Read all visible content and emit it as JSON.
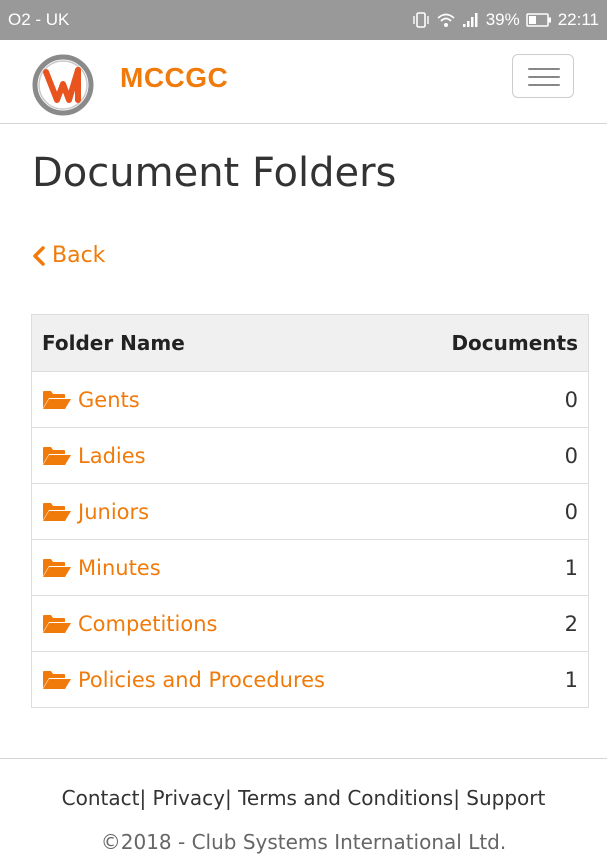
{
  "status_bar": {
    "carrier": "O2 - UK",
    "battery": "39%",
    "time": "22:11"
  },
  "navbar": {
    "brand": "MCCGC",
    "logo_icon": "club-logo-icon",
    "menu_icon": "hamburger-menu-icon"
  },
  "page": {
    "title": "Document Folders",
    "back_label": "Back"
  },
  "table": {
    "headers": {
      "name": "Folder Name",
      "count": "Documents"
    },
    "rows": [
      {
        "name": "Gents",
        "count": "0"
      },
      {
        "name": "Ladies",
        "count": "0"
      },
      {
        "name": "Juniors",
        "count": "0"
      },
      {
        "name": "Minutes",
        "count": "1"
      },
      {
        "name": "Competitions",
        "count": "2"
      },
      {
        "name": "Policies and Procedures",
        "count": "1"
      }
    ]
  },
  "footer": {
    "links": [
      "Contact",
      "Privacy",
      "Terms and Conditions",
      "Support"
    ],
    "copyright": "©2018 - Club Systems International Ltd."
  },
  "colors": {
    "accent": "#f07b0a",
    "status_bar": "#999999"
  }
}
